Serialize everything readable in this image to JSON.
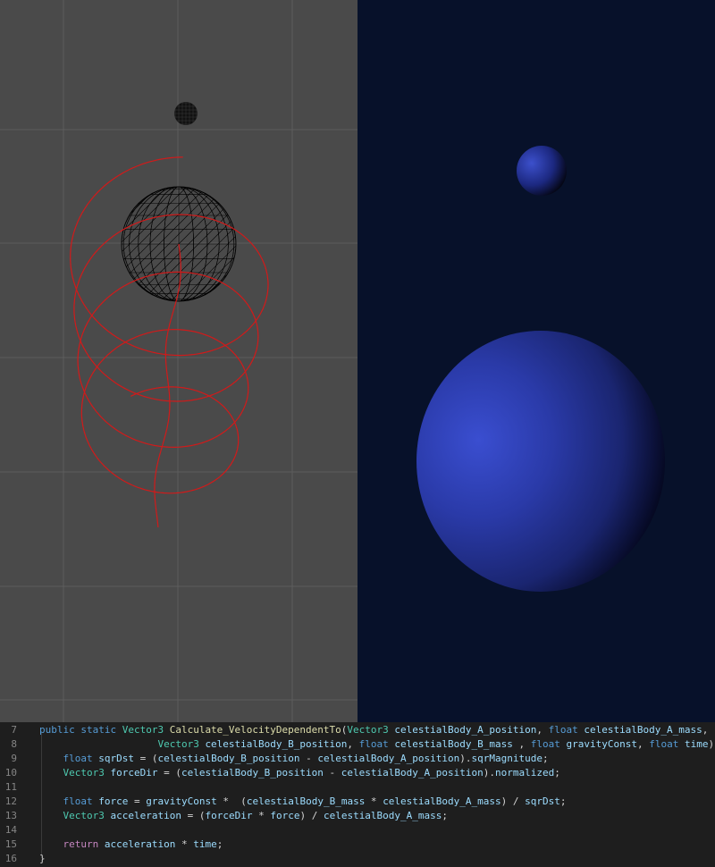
{
  "colors": {
    "scene_background": "#4a4a4a",
    "grid_line": "#5c5c5c",
    "orbit_trail": "#d11a1a",
    "wireframe": "#000000",
    "game_background": "#07112a",
    "planet_blue": "#2a3caa",
    "editor_background": "#1e1e1e"
  },
  "scene_view": {
    "planet_icon": "wireframe-sphere-icon",
    "moon_icon": "wireframe-moon-icon"
  },
  "game_view": {
    "moon_icon": "shaded-moon-icon",
    "planet_icon": "shaded-planet-icon"
  },
  "code": {
    "lines": [
      {
        "number": "7",
        "tokens": [
          {
            "t": "public static ",
            "c": "kw"
          },
          {
            "t": "Vector3 ",
            "c": "type"
          },
          {
            "t": "Calculate_VelocityDependentTo",
            "c": "fn"
          },
          {
            "t": "(",
            "c": "plain"
          },
          {
            "t": "Vector3 ",
            "c": "type"
          },
          {
            "t": "celestialBody_A_position",
            "c": "var"
          },
          {
            "t": ", ",
            "c": "plain"
          },
          {
            "t": "float ",
            "c": "kw"
          },
          {
            "t": "celestialBody_A_mass",
            "c": "var"
          },
          {
            "t": ",",
            "c": "plain"
          }
        ]
      },
      {
        "number": "8",
        "tokens": [
          {
            "t": "                    ",
            "c": "plain"
          },
          {
            "t": "Vector3 ",
            "c": "type"
          },
          {
            "t": "celestialBody_B_position",
            "c": "var"
          },
          {
            "t": ", ",
            "c": "plain"
          },
          {
            "t": "float ",
            "c": "kw"
          },
          {
            "t": "celestialBody_B_mass",
            "c": "var"
          },
          {
            "t": " , ",
            "c": "plain"
          },
          {
            "t": "float ",
            "c": "kw"
          },
          {
            "t": "gravityConst",
            "c": "var"
          },
          {
            "t": ", ",
            "c": "plain"
          },
          {
            "t": "float ",
            "c": "kw"
          },
          {
            "t": "time",
            "c": "var"
          },
          {
            "t": ") {",
            "c": "plain"
          }
        ]
      },
      {
        "number": "9",
        "tokens": [
          {
            "t": "    ",
            "c": "plain"
          },
          {
            "t": "float ",
            "c": "kw"
          },
          {
            "t": "sqrDst",
            "c": "var"
          },
          {
            "t": " = (",
            "c": "plain"
          },
          {
            "t": "celestialBody_B_position",
            "c": "var"
          },
          {
            "t": " - ",
            "c": "plain"
          },
          {
            "t": "celestialBody_A_position",
            "c": "var"
          },
          {
            "t": ").",
            "c": "plain"
          },
          {
            "t": "sqrMagnitude",
            "c": "var"
          },
          {
            "t": ";",
            "c": "plain"
          }
        ]
      },
      {
        "number": "10",
        "tokens": [
          {
            "t": "    ",
            "c": "plain"
          },
          {
            "t": "Vector3 ",
            "c": "type"
          },
          {
            "t": "forceDir",
            "c": "var"
          },
          {
            "t": " = (",
            "c": "plain"
          },
          {
            "t": "celestialBody_B_position",
            "c": "var"
          },
          {
            "t": " - ",
            "c": "plain"
          },
          {
            "t": "celestialBody_A_position",
            "c": "var"
          },
          {
            "t": ").",
            "c": "plain"
          },
          {
            "t": "normalized",
            "c": "var"
          },
          {
            "t": ";",
            "c": "plain"
          }
        ]
      },
      {
        "number": "11",
        "tokens": []
      },
      {
        "number": "12",
        "tokens": [
          {
            "t": "    ",
            "c": "plain"
          },
          {
            "t": "float ",
            "c": "kw"
          },
          {
            "t": "force",
            "c": "var"
          },
          {
            "t": " = ",
            "c": "plain"
          },
          {
            "t": "gravityConst",
            "c": "var"
          },
          {
            "t": " *  (",
            "c": "plain"
          },
          {
            "t": "celestialBody_B_mass",
            "c": "var"
          },
          {
            "t": " * ",
            "c": "plain"
          },
          {
            "t": "celestialBody_A_mass",
            "c": "var"
          },
          {
            "t": ") / ",
            "c": "plain"
          },
          {
            "t": "sqrDst",
            "c": "var"
          },
          {
            "t": ";",
            "c": "plain"
          }
        ]
      },
      {
        "number": "13",
        "tokens": [
          {
            "t": "    ",
            "c": "plain"
          },
          {
            "t": "Vector3 ",
            "c": "type"
          },
          {
            "t": "acceleration",
            "c": "var"
          },
          {
            "t": " = (",
            "c": "plain"
          },
          {
            "t": "forceDir",
            "c": "var"
          },
          {
            "t": " * ",
            "c": "plain"
          },
          {
            "t": "force",
            "c": "var"
          },
          {
            "t": ") / ",
            "c": "plain"
          },
          {
            "t": "celestialBody_A_mass",
            "c": "var"
          },
          {
            "t": ";",
            "c": "plain"
          }
        ]
      },
      {
        "number": "14",
        "tokens": []
      },
      {
        "number": "15",
        "tokens": [
          {
            "t": "    ",
            "c": "plain"
          },
          {
            "t": "return ",
            "c": "ctl"
          },
          {
            "t": "acceleration",
            "c": "var"
          },
          {
            "t": " * ",
            "c": "plain"
          },
          {
            "t": "time",
            "c": "var"
          },
          {
            "t": ";",
            "c": "plain"
          }
        ]
      },
      {
        "number": "16",
        "tokens": [
          {
            "t": "}",
            "c": "plain"
          }
        ]
      }
    ]
  }
}
